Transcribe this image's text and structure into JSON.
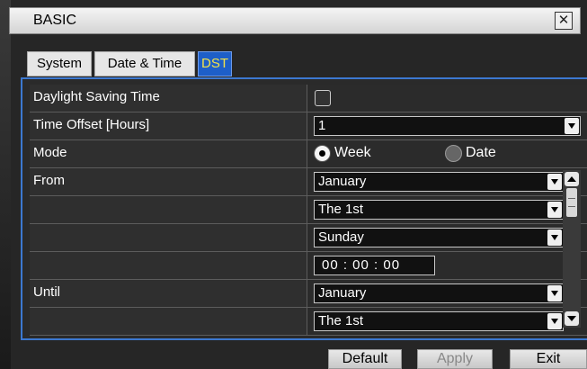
{
  "window": {
    "title": "BASIC",
    "close_glyph": "✕"
  },
  "tabs": [
    {
      "label": "System",
      "active": false
    },
    {
      "label": "Date & Time",
      "active": false
    },
    {
      "label": "DST",
      "active": true
    }
  ],
  "rows": {
    "dst_enable": {
      "label": "Daylight Saving Time",
      "checked": false
    },
    "offset": {
      "label": "Time Offset [Hours]",
      "value": "1"
    },
    "mode": {
      "label": "Mode",
      "option_week": "Week",
      "option_date": "Date",
      "selected": "Week"
    },
    "from": {
      "label": "From",
      "month": "January",
      "week": "The 1st",
      "day": "Sunday",
      "time": "00 : 00 : 00"
    },
    "until": {
      "label": "Until",
      "month": "January",
      "week": "The 1st"
    }
  },
  "buttons": {
    "default": "Default",
    "apply": "Apply",
    "exit": "Exit"
  },
  "colors": {
    "accent": "#1e5fc8",
    "active_tab_text": "#f2e24a",
    "panel_border": "#3c78d0"
  }
}
